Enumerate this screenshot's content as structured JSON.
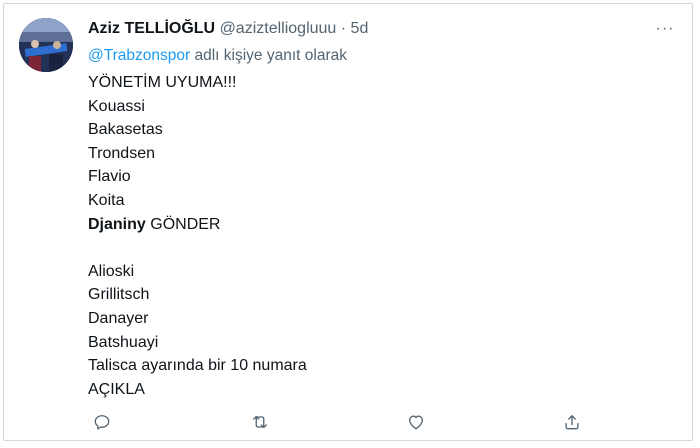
{
  "tweet": {
    "author_name": "Aziz TELLİOĞLU",
    "author_handle": "@aziztelliogluuu",
    "separator": "·",
    "time": "5d",
    "more_icon": "···",
    "reply_prefix": "@Trabzonspor",
    "reply_suffix": " adlı kişiye yanıt olarak",
    "lines": [
      "YÖNETİM UYUMA!!!",
      "Kouassi",
      "Bakasetas",
      "Trondsen",
      "Flavio",
      "Koita",
      "",
      "",
      "Alioski",
      "Grillitsch",
      "Danayer",
      "Batshuayi",
      "Talisca ayarında bir 10 numara",
      "AÇIKLA"
    ],
    "djaniny_bold": "Djaniny",
    "djaniny_rest": " GÖNDER",
    "icons": {
      "reply": "reply-icon",
      "retweet": "retweet-icon",
      "like": "like-icon",
      "share": "share-icon"
    },
    "colors": {
      "link": "#1d9bf0",
      "text": "#0f1419",
      "muted": "#536471",
      "border": "#cfd9de"
    }
  }
}
